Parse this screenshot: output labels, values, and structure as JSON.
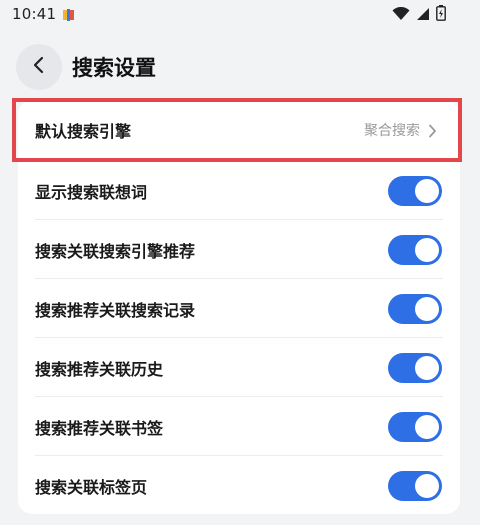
{
  "status_bar": {
    "time": "10:41",
    "icons": [
      "wifi-icon",
      "cellular-signal-icon",
      "battery-icon"
    ]
  },
  "header": {
    "back_icon": "chevron-left-icon",
    "title": "搜索设置"
  },
  "settings": {
    "default_engine": {
      "label": "默认搜索引擎",
      "value": "聚合搜索",
      "icon": "chevron-right-icon"
    },
    "toggles": [
      {
        "label": "显示搜索联想词",
        "enabled": true
      },
      {
        "label": "搜索关联搜索引擎推荐",
        "enabled": true
      },
      {
        "label": "搜索推荐关联搜索记录",
        "enabled": true
      },
      {
        "label": "搜索推荐关联历史",
        "enabled": true
      },
      {
        "label": "搜索推荐关联书签",
        "enabled": true
      },
      {
        "label": "搜索关联标签页",
        "enabled": true
      }
    ]
  },
  "colors": {
    "toggle_on": "#2f6fe6",
    "highlight": "#e4474a",
    "background": "#f2f3f5"
  }
}
